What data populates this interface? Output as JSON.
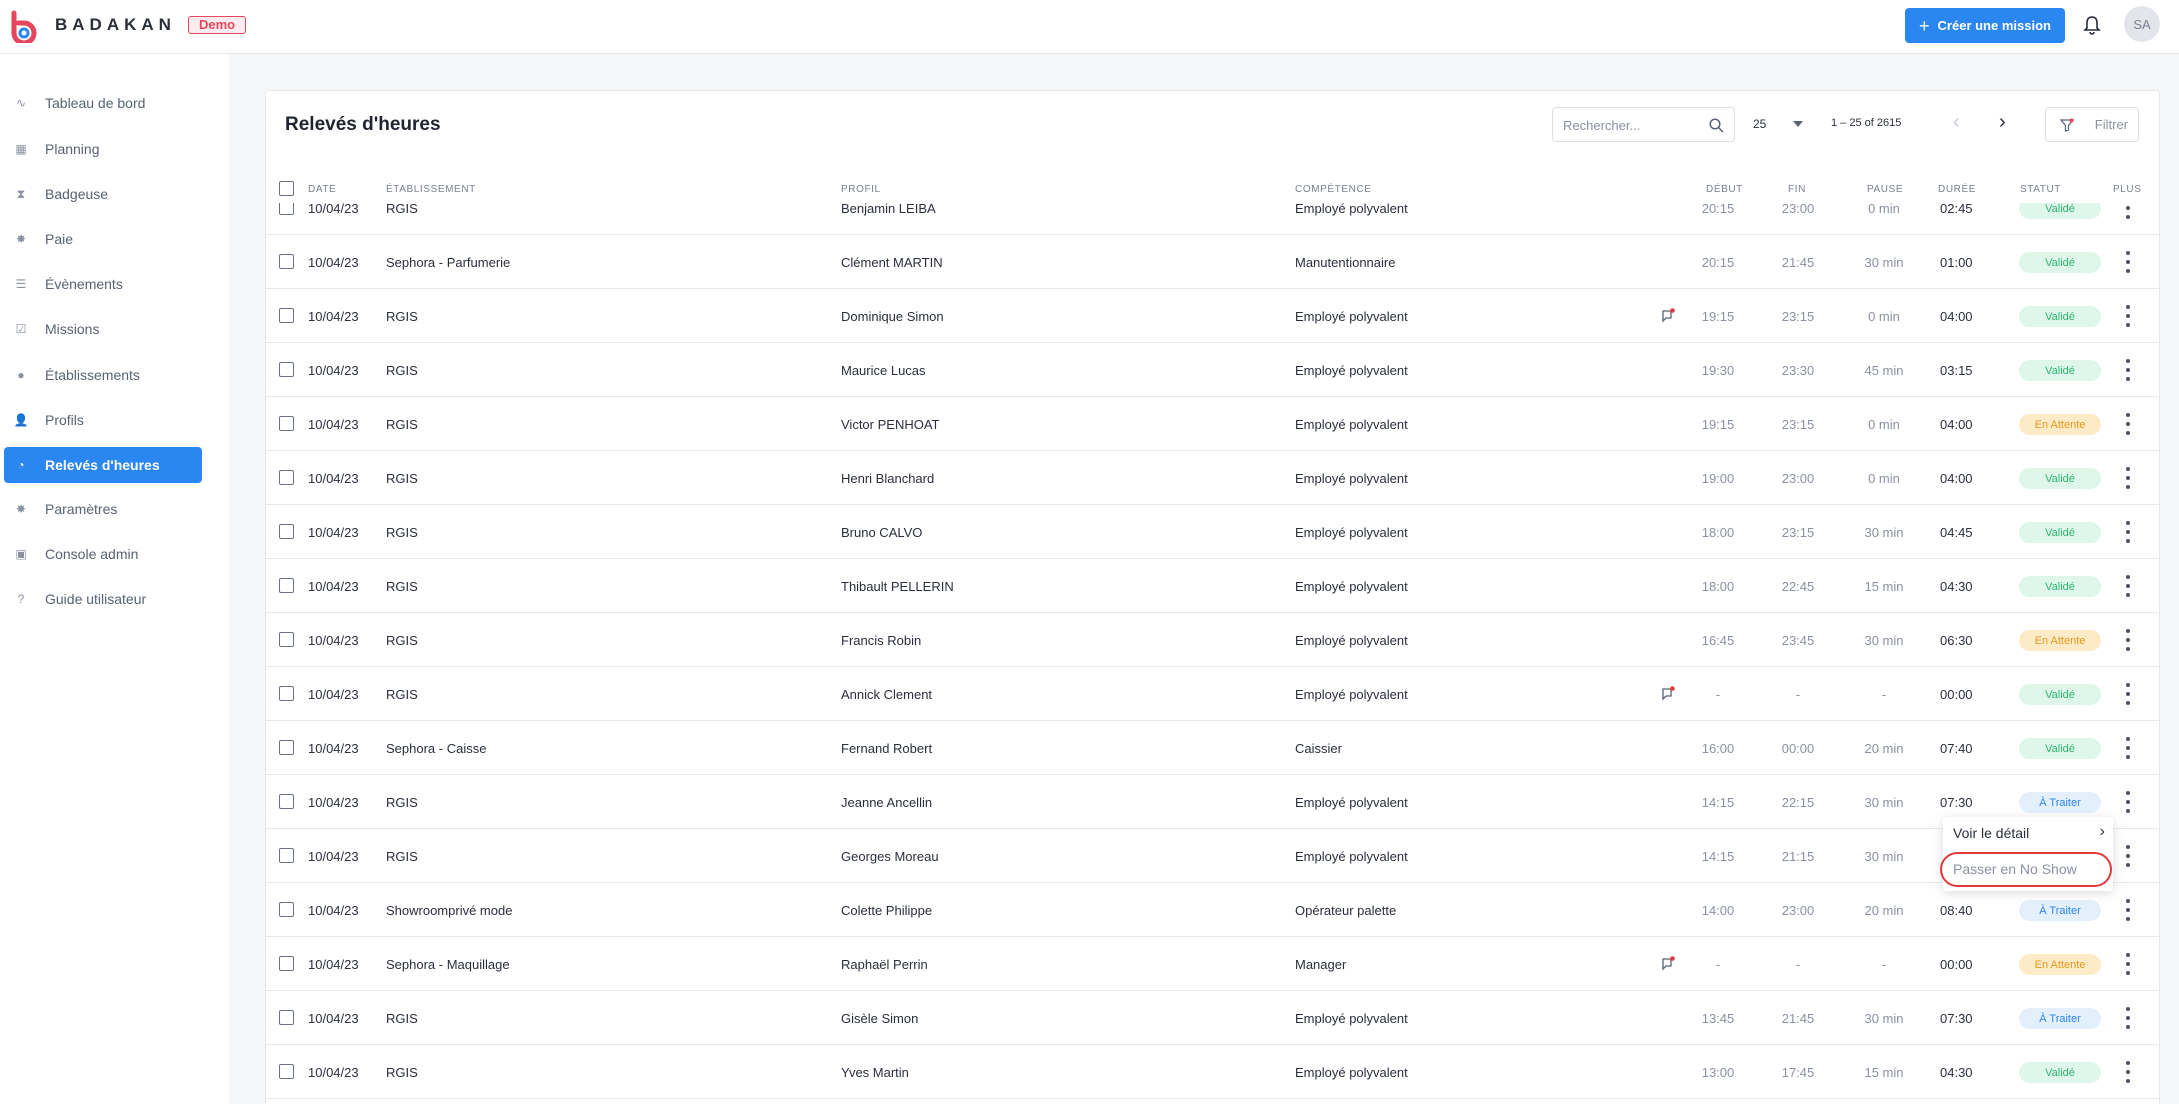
{
  "app": {
    "brand": "BADAKAN",
    "badge": "Demo",
    "create_label": "Créer une mission",
    "avatar_initials": "SA",
    "accent": "#2a86f0"
  },
  "nav": [
    {
      "label": "Tableau de bord",
      "icon": "dashboard-icon"
    },
    {
      "label": "Planning",
      "icon": "calendar-icon"
    },
    {
      "label": "Badgeuse",
      "icon": "hourglass-icon"
    },
    {
      "label": "Paie",
      "icon": "payroll-icon"
    },
    {
      "label": "Évènements",
      "icon": "events-icon"
    },
    {
      "label": "Missions",
      "icon": "missions-icon"
    },
    {
      "label": "Établissements",
      "icon": "building-icon"
    },
    {
      "label": "Profils",
      "icon": "users-icon"
    },
    {
      "label": "Relevés d'heures",
      "icon": "clock-icon",
      "active": true
    },
    {
      "label": "Paramètres",
      "icon": "settings-icon"
    },
    {
      "label": "Console admin",
      "icon": "admin-icon"
    },
    {
      "label": "Guide utilisateur",
      "icon": "help-icon"
    }
  ],
  "page": {
    "title": "Relevés d'heures",
    "search_placeholder": "Rechercher...",
    "per_page": "25",
    "range": "1 – 25 of 2615",
    "filter_label": "Filtrer"
  },
  "columns": {
    "date": "DATE",
    "etablissement": "ÉTABLISSEMENT",
    "profil": "PROFIL",
    "competence": "COMPÉTENCE",
    "debut": "DÉBUT",
    "fin": "FIN",
    "pause": "PAUSE",
    "duree": "DURÉE",
    "statut": "STATUT",
    "plus": "PLUS"
  },
  "rows": [
    {
      "date": "10/04/23",
      "etab": "RGIS",
      "profil": "Benjamin LEIBA",
      "comp": "Employé polyvalent",
      "debut": "20:15",
      "fin": "23:00",
      "pause": "0 min",
      "duree": "02:45",
      "statut": "Validé",
      "kind": "valid",
      "msg": false
    },
    {
      "date": "10/04/23",
      "etab": "Sephora - Parfumerie",
      "profil": "Clément MARTIN",
      "comp": "Manutentionnaire",
      "debut": "20:15",
      "fin": "21:45",
      "pause": "30 min",
      "duree": "01:00",
      "statut": "Validé",
      "kind": "valid",
      "msg": false
    },
    {
      "date": "10/04/23",
      "etab": "RGIS",
      "profil": "Dominique Simon",
      "comp": "Employé polyvalent",
      "debut": "19:15",
      "fin": "23:15",
      "pause": "0 min",
      "duree": "04:00",
      "statut": "Validé",
      "kind": "valid",
      "msg": true
    },
    {
      "date": "10/04/23",
      "etab": "RGIS",
      "profil": "Maurice Lucas",
      "comp": "Employé polyvalent",
      "debut": "19:30",
      "fin": "23:30",
      "pause": "45 min",
      "duree": "03:15",
      "statut": "Validé",
      "kind": "valid",
      "msg": false
    },
    {
      "date": "10/04/23",
      "etab": "RGIS",
      "profil": "Victor PENHOAT",
      "comp": "Employé polyvalent",
      "debut": "19:15",
      "fin": "23:15",
      "pause": "0 min",
      "duree": "04:00",
      "statut": "En Attente",
      "kind": "wait",
      "msg": false
    },
    {
      "date": "10/04/23",
      "etab": "RGIS",
      "profil": "Henri Blanchard",
      "comp": "Employé polyvalent",
      "debut": "19:00",
      "fin": "23:00",
      "pause": "0 min",
      "duree": "04:00",
      "statut": "Validé",
      "kind": "valid",
      "msg": false
    },
    {
      "date": "10/04/23",
      "etab": "RGIS",
      "profil": "Bruno CALVO",
      "comp": "Employé polyvalent",
      "debut": "18:00",
      "fin": "23:15",
      "pause": "30 min",
      "duree": "04:45",
      "statut": "Validé",
      "kind": "valid",
      "msg": false
    },
    {
      "date": "10/04/23",
      "etab": "RGIS",
      "profil": "Thibault PELLERIN",
      "comp": "Employé polyvalent",
      "debut": "18:00",
      "fin": "22:45",
      "pause": "15 min",
      "duree": "04:30",
      "statut": "Validé",
      "kind": "valid",
      "msg": false
    },
    {
      "date": "10/04/23",
      "etab": "RGIS",
      "profil": "Francis Robin",
      "comp": "Employé polyvalent",
      "debut": "16:45",
      "fin": "23:45",
      "pause": "30 min",
      "duree": "06:30",
      "statut": "En Attente",
      "kind": "wait",
      "msg": false
    },
    {
      "date": "10/04/23",
      "etab": "RGIS",
      "profil": "Annick Clement",
      "comp": "Employé polyvalent",
      "debut": "-",
      "fin": "-",
      "pause": "-",
      "duree": "00:00",
      "statut": "Validé",
      "kind": "valid",
      "msg": true
    },
    {
      "date": "10/04/23",
      "etab": "Sephora - Caisse",
      "profil": "Fernand Robert",
      "comp": "Caissier",
      "debut": "16:00",
      "fin": "00:00",
      "pause": "20 min",
      "duree": "07:40",
      "statut": "Validé",
      "kind": "valid",
      "msg": false
    },
    {
      "date": "10/04/23",
      "etab": "RGIS",
      "profil": "Jeanne Ancellin",
      "comp": "Employé polyvalent",
      "debut": "14:15",
      "fin": "22:15",
      "pause": "30 min",
      "duree": "07:30",
      "statut": "À Traiter",
      "kind": "todo",
      "msg": false
    },
    {
      "date": "10/04/23",
      "etab": "RGIS",
      "profil": "Georges Moreau",
      "comp": "Employé polyvalent",
      "debut": "14:15",
      "fin": "21:15",
      "pause": "30 min",
      "duree": "",
      "statut": "",
      "kind": "none",
      "msg": false
    },
    {
      "date": "10/04/23",
      "etab": "Showroomprivé mode",
      "profil": "Colette Philippe",
      "comp": "Opérateur palette",
      "debut": "14:00",
      "fin": "23:00",
      "pause": "20 min",
      "duree": "08:40",
      "statut": "À Traiter",
      "kind": "todo",
      "msg": false
    },
    {
      "date": "10/04/23",
      "etab": "Sephora - Maquillage",
      "profil": "Raphaël Perrin",
      "comp": "Manager",
      "debut": "-",
      "fin": "-",
      "pause": "-",
      "duree": "00:00",
      "statut": "En Attente",
      "kind": "wait",
      "msg": true
    },
    {
      "date": "10/04/23",
      "etab": "RGIS",
      "profil": "Gisèle Simon",
      "comp": "Employé polyvalent",
      "debut": "13:45",
      "fin": "21:45",
      "pause": "30 min",
      "duree": "07:30",
      "statut": "À Traiter",
      "kind": "todo",
      "msg": false
    },
    {
      "date": "10/04/23",
      "etab": "RGIS",
      "profil": "Yves Martin",
      "comp": "Employé polyvalent",
      "debut": "13:00",
      "fin": "17:45",
      "pause": "15 min",
      "duree": "04:30",
      "statut": "Validé",
      "kind": "valid",
      "msg": false
    }
  ],
  "context_menu": {
    "detail": "Voir le détail",
    "no_show": "Passer en No Show"
  }
}
